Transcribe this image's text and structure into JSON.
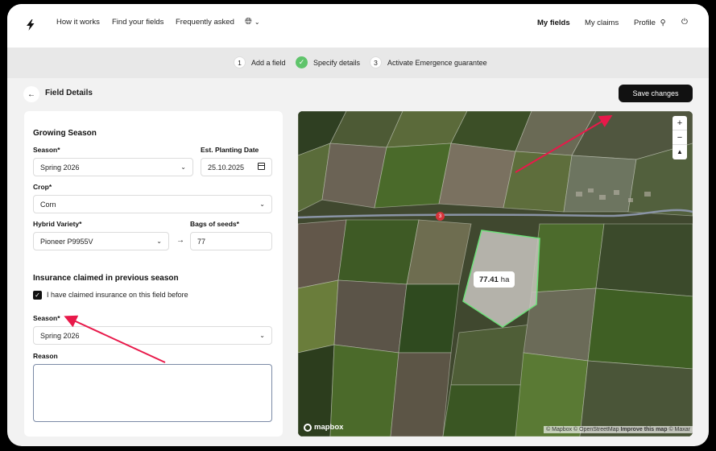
{
  "nav": {
    "links": [
      "How it works",
      "Find your fields",
      "Frequently asked"
    ],
    "right": [
      "My fields",
      "My claims",
      "Profile"
    ]
  },
  "stepper": {
    "steps": [
      {
        "num": "1",
        "label": "Add a field",
        "state": "number"
      },
      {
        "num": "",
        "label": "Specify details",
        "state": "done"
      },
      {
        "num": "3",
        "label": "Activate Emergence guarantee",
        "state": "number"
      }
    ]
  },
  "page": {
    "title": "Field Details",
    "save_label": "Save changes"
  },
  "form": {
    "growing_title": "Growing Season",
    "season_label": "Season*",
    "season_value": "Spring 2026",
    "planting_label": "Est. Planting Date",
    "planting_value": "25.10.2025",
    "crop_label": "Crop*",
    "crop_value": "Corn",
    "hybrid_label": "Hybrid Variety*",
    "hybrid_value": "Pioneer P9955V",
    "bags_label": "Bags of seeds*",
    "bags_value": "77",
    "insurance_title": "Insurance claimed in previous season",
    "claimed_label": "I have claimed insurance on this field before",
    "claimed_checked": true,
    "season2_label": "Season*",
    "season2_value": "Spring 2026",
    "reason_label": "Reason",
    "reason_value": ""
  },
  "map": {
    "area_value": "77.41",
    "area_unit": "ha",
    "logo_text": "mapbox",
    "road_shield": "3",
    "attribution_prefix": "© Mapbox © OpenStreetMap",
    "attribution_improve": "Improve this map",
    "attribution_suffix": "© Maxar",
    "zoom_in": "+",
    "zoom_out": "−"
  },
  "colors": {
    "accent_dark": "#111111",
    "success": "#5fc46b",
    "annotation_arrow": "#e8194a"
  }
}
